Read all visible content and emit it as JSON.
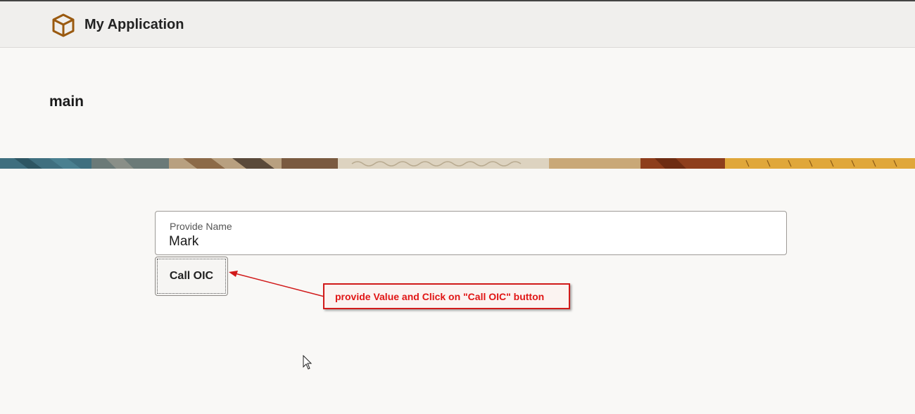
{
  "header": {
    "app_title": "My Application",
    "logo_icon": "cube-icon"
  },
  "page": {
    "title": "main"
  },
  "form": {
    "name_field": {
      "label": "Provide Name",
      "value": "Mark"
    },
    "call_button_label": "Call OIC"
  },
  "annotation": {
    "text": "provide Value and Click on \"Call OIC\" button"
  },
  "colors": {
    "logo_accent": "#9a5a10",
    "annotation_red": "#e01515",
    "page_bg": "#f9f8f6",
    "header_bg": "#f0efed"
  }
}
